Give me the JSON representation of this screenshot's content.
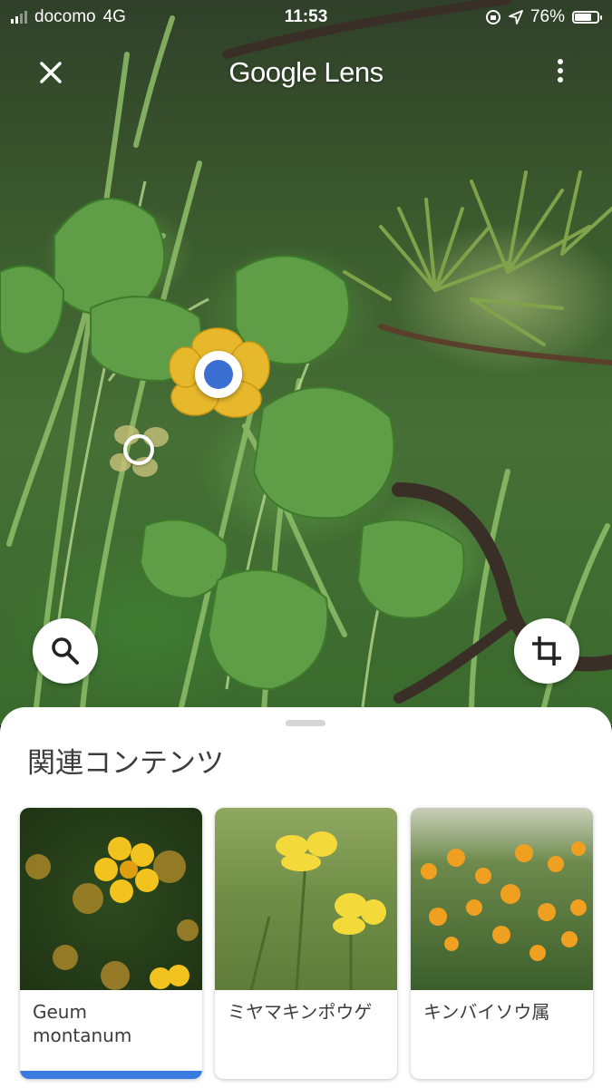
{
  "status_bar": {
    "carrier": "docomo",
    "network": "4G",
    "time": "11:53",
    "battery": "76%",
    "battery_level": 0.76
  },
  "header": {
    "title": "Google Lens",
    "close_icon": "close-icon",
    "more_icon": "more-vert-icon"
  },
  "controls": {
    "search_icon": "search-icon",
    "crop_icon": "crop-icon"
  },
  "colors": {
    "accent_blue": "#3a6fd1",
    "selection_bar": "#3a7be0",
    "sheet_background": "#ffffff",
    "text": "#3c3c3c"
  },
  "results": {
    "heading": "関連コンテンツ",
    "cards": [
      {
        "label": "Geum montanum",
        "selected": true
      },
      {
        "label": "ミヤマキンポウゲ",
        "selected": false
      },
      {
        "label": "キンバイソウ属",
        "selected": false
      }
    ]
  }
}
